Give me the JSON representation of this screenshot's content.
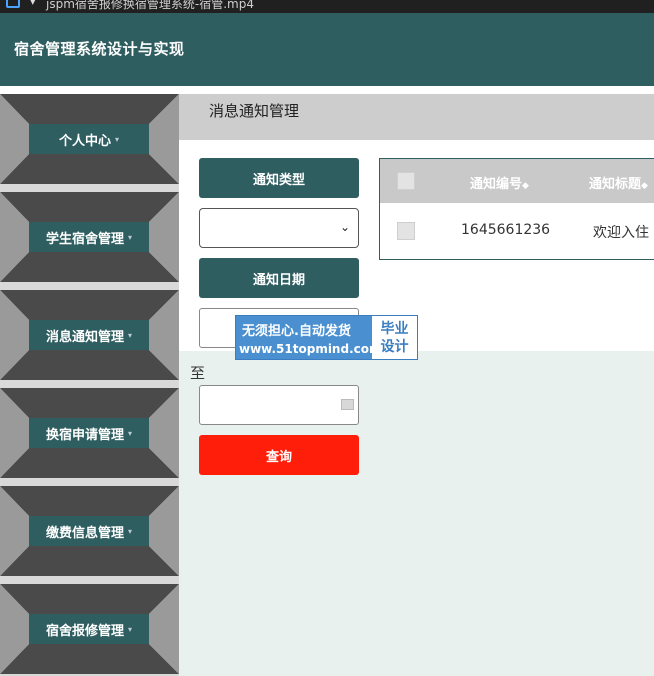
{
  "window": {
    "title": "jspm宿舍报修换宿管理系统-宿管.mp4"
  },
  "header": {
    "app_title": "宿舍管理系统设计与实现"
  },
  "sidebar": {
    "items": [
      {
        "label": "个人中心"
      },
      {
        "label": "学生宿舍管理"
      },
      {
        "label": "消息通知管理"
      },
      {
        "label": "换宿申请管理"
      },
      {
        "label": "缴费信息管理"
      },
      {
        "label": "宿舍报修管理"
      }
    ],
    "caret": "▾"
  },
  "breadcrumb": {
    "current": "消息通知管理"
  },
  "search": {
    "type_label": "通知类型",
    "type_value": "",
    "date_label": "通知日期",
    "date_from": "",
    "range_sep": "至",
    "date_to": "",
    "query_label": "查询"
  },
  "table": {
    "columns": [
      "通知编号",
      "通知标题"
    ],
    "sort_glyph": "◆",
    "rows": [
      {
        "number": "1645661236",
        "title": "欢迎入住"
      }
    ]
  },
  "watermark": {
    "line1": "无须担心.自动发货",
    "line2": "www.51topmind.com",
    "badge_top": "毕业",
    "badge_bottom": "设计"
  },
  "colors": {
    "header_bg": "#2f5e61",
    "sidebar_bg": "#d9d9d9",
    "query_button": "#ff1e0a",
    "main_bg": "#e8f1ee"
  }
}
